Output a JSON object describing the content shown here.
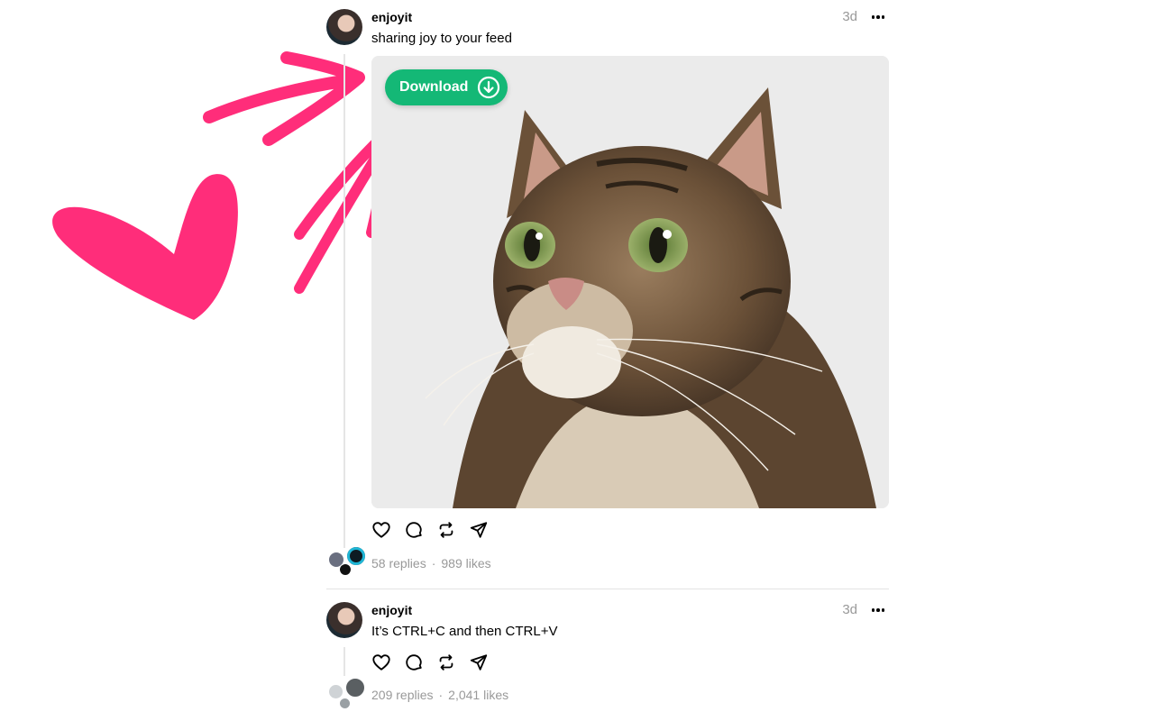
{
  "posts": [
    {
      "username": "enjoyit",
      "time": "3d",
      "text": "sharing joy to your feed",
      "download_label": "Download",
      "stats": {
        "replies": "58 replies",
        "likes": "989 likes"
      }
    },
    {
      "username": "enjoyit",
      "time": "3d",
      "text": "It’s CTRL+C and then CTRL+V",
      "stats": {
        "replies": "209 replies",
        "likes": "2,041 likes"
      }
    }
  ],
  "actions": [
    "heart-icon",
    "comment-icon",
    "repost-icon",
    "share-icon"
  ],
  "colors": {
    "download_green": "#14b876",
    "annotation_pink": "#ff2d7a",
    "muted_text": "#999999"
  }
}
